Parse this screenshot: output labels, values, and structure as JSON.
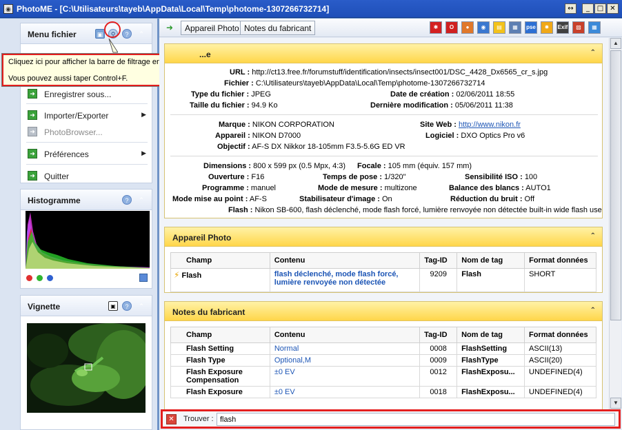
{
  "window": {
    "title": "PhotoME - [C:\\Utilisateurs\\tayeb\\AppData\\Local\\Temp\\photome-1307266732714]",
    "buttons": [
      "↔",
      "_",
      "□",
      "✕"
    ]
  },
  "left": {
    "menu_title": "Menu fichier",
    "menu_items": [
      {
        "label": "Enregistrer sous...",
        "enabled": true
      },
      {
        "label": "Importer/Exporter",
        "enabled": true,
        "submenu": true
      },
      {
        "label": "PhotoBrowser...",
        "enabled": false
      },
      {
        "label": "Préférences",
        "enabled": true,
        "submenu": true
      },
      {
        "label": "Quitter",
        "enabled": true
      }
    ],
    "histogram_title": "Histogramme",
    "thumbnail_title": "Vignette"
  },
  "tooltip": {
    "line1": "Cliquez ici pour afficher la barre de filtrage en bas de la fenêtre.",
    "line2": "Vous pouvez aussi taper Control+F."
  },
  "toolbar": {
    "tabs": [
      "Appareil Photo",
      "Notes du fabricant"
    ],
    "icons": [
      {
        "name": "red-splat-icon",
        "color": "#d42020",
        "glyph": "✱"
      },
      {
        "name": "opera-icon",
        "color": "#d02020",
        "glyph": "O"
      },
      {
        "name": "firefox-icon",
        "color": "#e0782a",
        "glyph": "●"
      },
      {
        "name": "chrome-icon",
        "color": "#3a78d0",
        "glyph": "◉"
      },
      {
        "name": "yellow-note-icon",
        "color": "#f3c21b",
        "glyph": "▤"
      },
      {
        "name": "document-icon",
        "color": "#5d7fb3",
        "glyph": "▦"
      },
      {
        "name": "dpse-icon",
        "color": "#2c6fd4",
        "glyph": "pse"
      },
      {
        "name": "sun-icon",
        "color": "#f0a818",
        "glyph": "✹"
      },
      {
        "name": "exif-icon",
        "color": "#404040",
        "glyph": "Exif"
      },
      {
        "name": "chart-icon",
        "color": "#c8402a",
        "glyph": "▨"
      },
      {
        "name": "grid-icon",
        "color": "#3b8ad9",
        "glyph": "▦"
      }
    ]
  },
  "general": {
    "title_partial": "...e",
    "url_label": "URL :",
    "url": "http://ct13.free.fr/forumstuff/identification/insects/insect001/DSC_4428_Dx6565_cr_s.jpg",
    "file_label": "Fichier :",
    "file": "C:\\Utilisateurs\\tayeb\\AppData\\Local\\Temp\\photome-1307266732714",
    "type_label": "Type du fichier :",
    "type": "JPEG",
    "size_label": "Taille du fichier :",
    "size": "94.9 Ko",
    "created_label": "Date de création :",
    "created": "02/06/2011 18:55",
    "modified_label": "Dernière modification :",
    "modified": "05/06/2011 11:38",
    "brand_label": "Marque :",
    "brand": "NIKON CORPORATION",
    "camera_label": "Appareil :",
    "camera": "NIKON D7000",
    "lens_label": "Objectif :",
    "lens": "AF-S DX Nikkor 18-105mm F3.5-5.6G ED VR",
    "website_label": "Site Web :",
    "website": "http://www.nikon.fr",
    "software_label": "Logiciel :",
    "software": "DXO Optics Pro v6",
    "dims_label": "Dimensions :",
    "dims": "800 x 599 px (0.5 Mpx, 4:3)",
    "focal_label": "Focale :",
    "focal": "105 mm (équiv. 157 mm)",
    "aperture_label": "Ouverture :",
    "aperture": "F16",
    "exposure_label": "Temps de pose :",
    "exposure": "1/320\"",
    "iso_label": "Sensibilité ISO :",
    "iso": "100",
    "program_label": "Programme :",
    "program": "manuel",
    "metering_label": "Mode de mesure :",
    "metering": "multizone",
    "wb_label": "Balance des blancs :",
    "wb": "AUTO1",
    "focus_label": "Mode mise au point :",
    "focus": "AF-S",
    "stab_label": "Stabilisateur d'image :",
    "stab": "On",
    "noise_label": "Réduction du bruit :",
    "noise": "Off",
    "flash_label": "Flash :",
    "flash": "Nikon SB-600, flash déclenché, mode flash forcé, lumière renvoyée non détectée built-in wide flash use"
  },
  "camera_section": {
    "title": "Appareil Photo",
    "headers": [
      "Champ",
      "Contenu",
      "Tag-ID",
      "Nom de tag",
      "Format données"
    ],
    "rows": [
      {
        "champ": "Flash",
        "contenu": "flash déclenché, mode flash forcé, lumière renvoyée non détectée",
        "tag": "9209",
        "nom": "Flash",
        "format": "SHORT"
      }
    ]
  },
  "maker_section": {
    "title": "Notes du fabricant",
    "headers": [
      "Champ",
      "Contenu",
      "Tag-ID",
      "Nom de tag",
      "Format données"
    ],
    "rows": [
      {
        "champ": "Flash Setting",
        "contenu": "Normal",
        "tag": "0008",
        "nom": "FlashSetting",
        "format": "ASCII(13)"
      },
      {
        "champ": "Flash Type",
        "contenu": "Optional,M",
        "tag": "0009",
        "nom": "FlashType",
        "format": "ASCII(20)"
      },
      {
        "champ": "Flash Exposure Compensation",
        "contenu": "±0 EV",
        "tag": "0012",
        "nom": "FlashExposu...",
        "format": "UNDEFINED(4)"
      },
      {
        "champ": "Flash Exposure",
        "contenu": "±0 EV",
        "tag": "0018",
        "nom": "FlashExposu...",
        "format": "UNDEFINED(4)"
      }
    ]
  },
  "findbar": {
    "label": "Trouver :",
    "value": "flash"
  },
  "colors": {
    "accent_red": "#e41e1e",
    "section_header": "#ffd64a",
    "link_blue": "#1c55b5",
    "titlebar": "#2a5cc9"
  }
}
